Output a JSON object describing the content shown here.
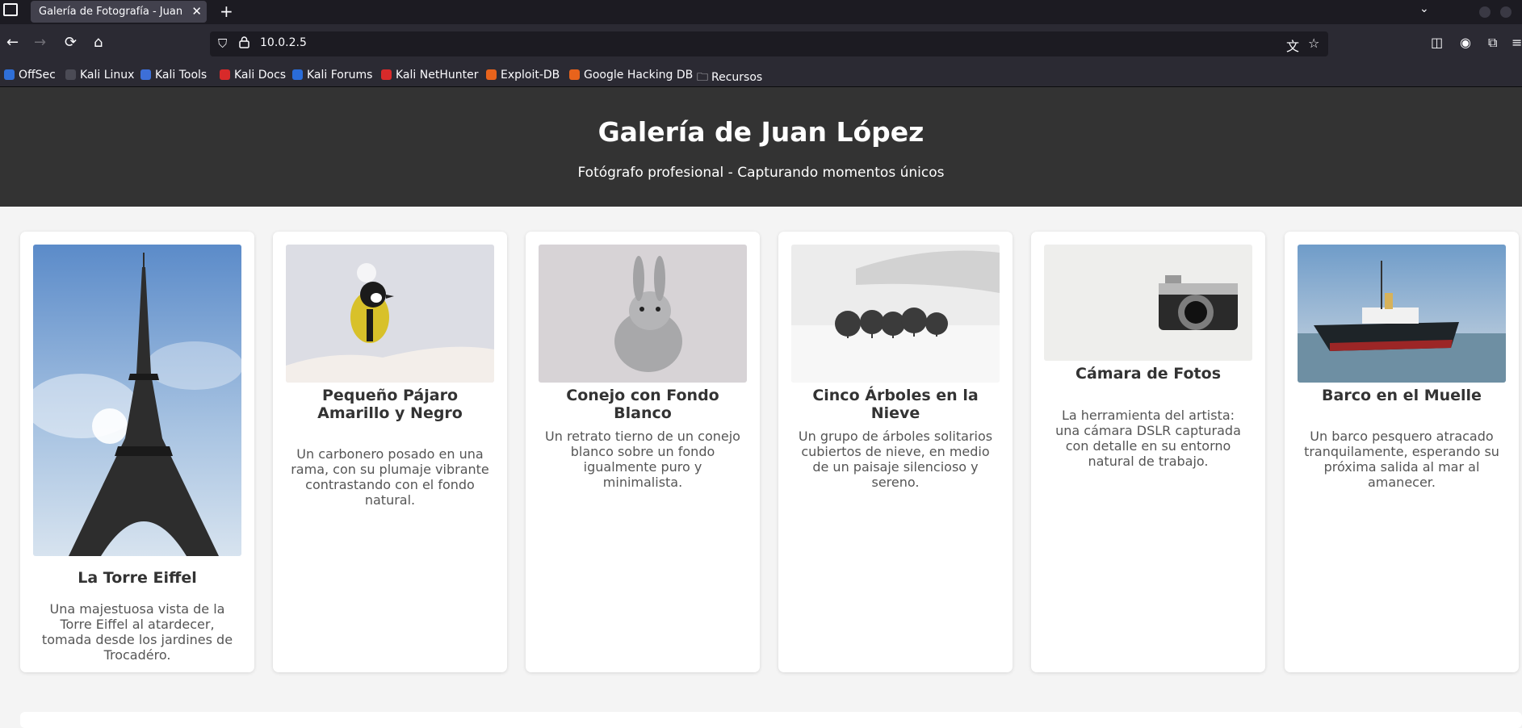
{
  "browser": {
    "tab_title": "Galería de Fotografía - Juan L",
    "tab_close": "✕",
    "new_tab": "+",
    "url": "10.0.2.5",
    "bookmarks": [
      {
        "label": "OffSec",
        "color": "#2f6fd8"
      },
      {
        "label": "Kali Linux",
        "color": "#4b4b55"
      },
      {
        "label": "Kali Tools",
        "color": "#3d6fd8"
      },
      {
        "label": "Kali Docs",
        "color": "#d82a2a"
      },
      {
        "label": "Kali Forums",
        "color": "#2a6cd8"
      },
      {
        "label": "Kali NetHunter",
        "color": "#d82a2a"
      },
      {
        "label": "Exploit-DB",
        "color": "#e8631c"
      },
      {
        "label": "Google Hacking DB",
        "color": "#e8631c"
      },
      {
        "label": "Recursos",
        "color": "#00000000"
      }
    ]
  },
  "header": {
    "title": "Galería de Juan López",
    "subtitle": "Fotógrafo profesional - Capturando momentos únicos"
  },
  "gallery": [
    {
      "title": "La Torre Eiffel",
      "description": "Una majestuosa vista de la Torre Eiffel al atardecer, tomada desde los jardines de Trocadéro."
    },
    {
      "title": "Pequeño Pájaro Amarillo y Negro",
      "description": "Un carbonero posado en una rama, con su plumaje vibrante contrastando con el fondo natural."
    },
    {
      "title": "Conejo con Fondo Blanco",
      "description": "Un retrato tierno de un conejo blanco sobre un fondo igualmente puro y minimalista."
    },
    {
      "title": "Cinco Árboles en la Nieve",
      "description": "Un grupo de árboles solitarios cubiertos de nieve, en medio de un paisaje silencioso y sereno."
    },
    {
      "title": "Cámara de Fotos",
      "description": "La herramienta del artista: una cámara DSLR capturada con detalle en su entorno natural de trabajo."
    },
    {
      "title": "Barco en el Muelle",
      "description": "Un barco pesquero atracado tranquilamente, esperando su próxima salida al mar al amanecer."
    }
  ]
}
